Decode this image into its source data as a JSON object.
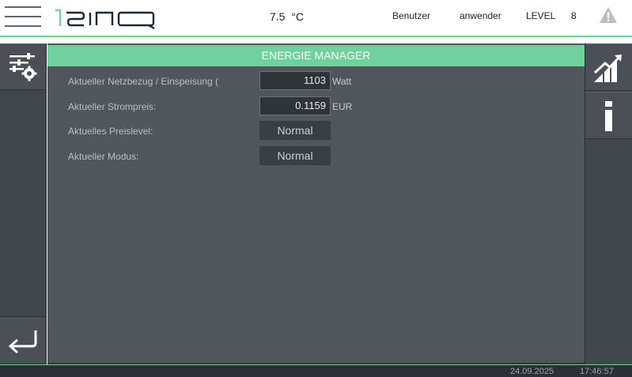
{
  "header": {
    "temperature": {
      "value": "7.5",
      "unit": "°C"
    },
    "user_label": "Benutzer",
    "user_name": "anwender",
    "level_label": "LEVEL",
    "level_value": "8"
  },
  "main": {
    "title": "ENERGIE MANAGER",
    "rows": [
      {
        "label": "Aktueller Netzbezug / Einspeisung (",
        "value": "1103",
        "unit": "Watt"
      },
      {
        "label": "Aktueller Strompreis:",
        "value": "0.1159",
        "unit": "EUR"
      },
      {
        "label": "Aktuelles Preislevel:",
        "value": "Normal"
      },
      {
        "label": "Aktueller Modus:",
        "value": "Normal"
      }
    ]
  },
  "status": {
    "date": "24.09.2025",
    "time": "17:46:57"
  },
  "colors": {
    "accent": "#6fd19b",
    "panel": "#50565c",
    "sidebar": "#42474d"
  },
  "icons": {
    "menu": "hamburger-icon",
    "logo": "isinq-logo",
    "warning": "warning-icon",
    "settings": "settings-sliders-icon",
    "back": "back-arrow-icon",
    "chart": "chart-trend-icon",
    "info": "info-icon"
  }
}
